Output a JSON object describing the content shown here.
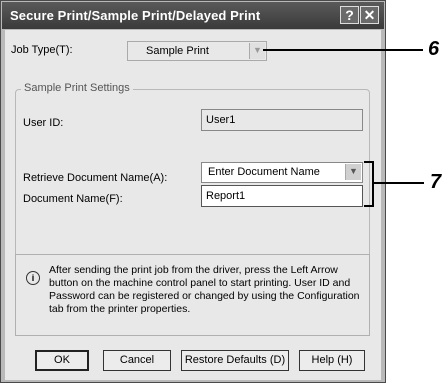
{
  "window": {
    "title": "Secure Print/Sample Print/Delayed Print",
    "help_glyph": "?",
    "close_glyph": "✕"
  },
  "job_type": {
    "label": "Job Type(T):",
    "value": "Sample Print"
  },
  "settings_group": {
    "title": "Sample Print Settings",
    "user_id_label": "User ID:",
    "user_id_value": "User1",
    "retrieve_label": "Retrieve Document Name(A):",
    "retrieve_value": "Enter Document Name",
    "doc_name_label": "Document Name(F):",
    "doc_name_value": "Report1"
  },
  "info": {
    "text": "After sending the print job from the driver, press the Left Arrow button on the machine control panel to start printing. User ID and Password can be registered or changed by using the Configuration tab from the printer properties."
  },
  "buttons": {
    "ok": "OK",
    "cancel": "Cancel",
    "restore": "Restore Defaults (D)",
    "help": "Help (H)"
  },
  "callouts": {
    "six": "6",
    "seven": "7"
  }
}
